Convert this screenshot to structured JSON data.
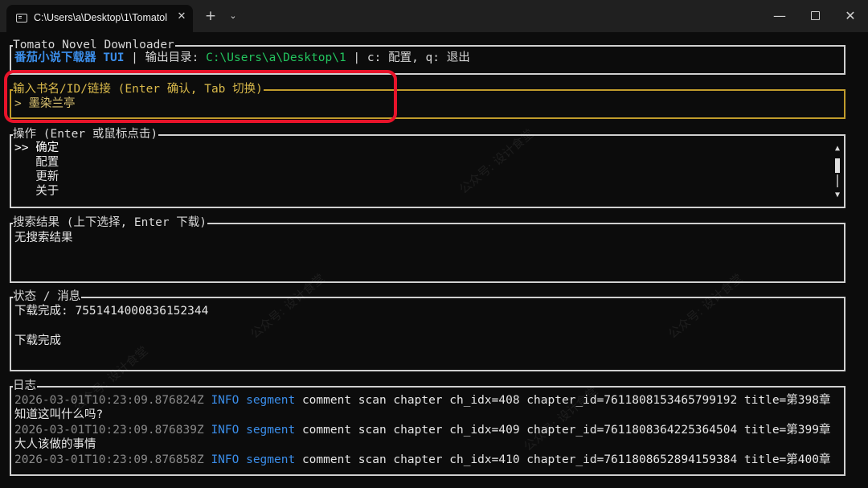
{
  "window": {
    "tab_title": "C:\\Users\\a\\Desktop\\1\\Tomatol",
    "tab_close": "✕",
    "new_tab": "+",
    "tab_dropdown": "⌄",
    "minimize": "—",
    "close": "✕"
  },
  "header": {
    "panel_title": "Tomato Novel Downloader",
    "app_name": "番茄小说下载器 TUI",
    "sep1": " | ",
    "output_label": "输出目录: ",
    "output_path": "C:\\Users\\a\\Desktop\\1",
    "sep2": " | ",
    "hotkeys": "c: 配置, q: 退出"
  },
  "input": {
    "panel_title": "输入书名/ID/链接 (Enter 确认, Tab 切换)",
    "value": "> 墨染兰亭"
  },
  "operations": {
    "panel_title": "操作 (Enter 或鼠标点击)",
    "items": [
      {
        "label": ">> 确定",
        "selected": true
      },
      {
        "label": "   配置",
        "selected": false
      },
      {
        "label": "   更新",
        "selected": false
      },
      {
        "label": "   关于",
        "selected": false
      }
    ],
    "scroll_up": "▲",
    "scroll_down": "▼"
  },
  "results": {
    "panel_title": "搜索结果 (上下选择, Enter 下载)",
    "empty_text": "无搜索结果"
  },
  "status": {
    "panel_title": "状态 / 消息",
    "line1": "下载完成: 7551414000836152344",
    "line2": "下载完成"
  },
  "log": {
    "panel_title": "日志",
    "entries": [
      {
        "timestamp": "2026-03-01T10:23:09.876824Z",
        "level": "INFO",
        "target": "segment",
        "message": "comment scan chapter ch_idx=408 chapter_id=7611808153465799192 title=第398章",
        "continuation": "知道这叫什么吗?"
      },
      {
        "timestamp": "2026-03-01T10:23:09.876839Z",
        "level": "INFO",
        "target": "segment",
        "message": "comment scan chapter ch_idx=409 chapter_id=7611808364225364504 title=第399章",
        "continuation": "大人该做的事情"
      },
      {
        "timestamp": "2026-03-01T10:23:09.876858Z",
        "level": "INFO",
        "target": "segment",
        "message": "comment scan chapter ch_idx=410 chapter_id=7611808652894159384 title=第400章",
        "continuation": ""
      }
    ]
  },
  "watermark_text": "公众号: 设计食堂"
}
